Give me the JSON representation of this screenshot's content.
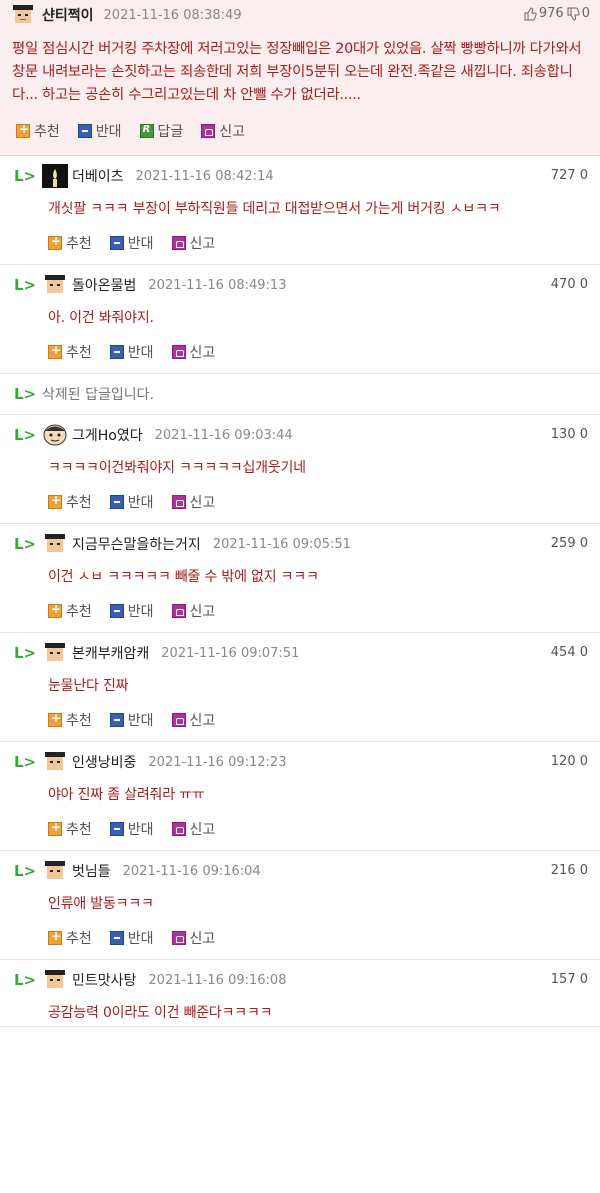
{
  "main_post": {
    "nick": "샨티쩍이",
    "date": "2021-11-16 08:38:49",
    "up_count": "976",
    "down_count": "0",
    "text": "평일 점심시간 버거킹 주차장에 저러고있는 정장빼입은 20대가 있었음. 살짝 빵빵하니까 다가와서 창문 내려보라는 손짓하고는 죄송한데 저희 부장이5분뒤 오는데 완전.족같은 새낍니다. 죄송합니다... 하고는 공손히 수그리고있는데 차 안뺄 수가 없더라.....",
    "actions": {
      "recommend": "추천",
      "oppose": "반대",
      "reply": "답글",
      "report": "신고"
    }
  },
  "comment_actions": {
    "recommend": "추천",
    "oppose": "반대",
    "report": "신고"
  },
  "comments": [
    {
      "nick": "더베이츠",
      "date": "2021-11-16 08:42:14",
      "votes": "727 0",
      "text": "개싯팔 ㅋㅋㅋ 부장이 부하직원들 데리고 대접받으면서 가는게 버거킹 ㅅㅂㅋㅋ"
    },
    {
      "nick": "돌아온물범",
      "date": "2021-11-16 08:49:13",
      "votes": "470 0",
      "text": "아. 이건 봐줘야지."
    },
    {
      "nick": "그게Ho였다",
      "date": "2021-11-16 09:03:44",
      "votes": "130 0",
      "text": "ㅋㅋㅋㅋ이건봐줘야지 ㅋㅋㅋㅋㅋ십개웃기네"
    },
    {
      "nick": "지금무슨말을하는거지",
      "date": "2021-11-16 09:05:51",
      "votes": "259 0",
      "text": "이건 ㅅㅂ ㅋㅋㅋㅋㅋ 빼줄 수 밖에 없지 ㅋㅋㅋ"
    },
    {
      "nick": "본캐부캐암캐",
      "date": "2021-11-16 09:07:51",
      "votes": "454 0",
      "text": "눈물난다 진짜"
    },
    {
      "nick": "인생낭비중",
      "date": "2021-11-16 09:12:23",
      "votes": "120 0",
      "text": "야아 진짜 좀 살려줘라 ㅠㅠ"
    },
    {
      "nick": "벗님들",
      "date": "2021-11-16 09:16:04",
      "votes": "216 0",
      "text": "인류애 발동ㅋㅋㅋ"
    },
    {
      "nick": "민트맛사탕",
      "date": "2021-11-16 09:16:08",
      "votes": "157 0",
      "text": "공감능력 0이라도 이건 빼준다ㅋㅋㅋㅋ"
    }
  ],
  "deleted_text": "삭제된 답글입니다.",
  "reply_arrow": "L>"
}
